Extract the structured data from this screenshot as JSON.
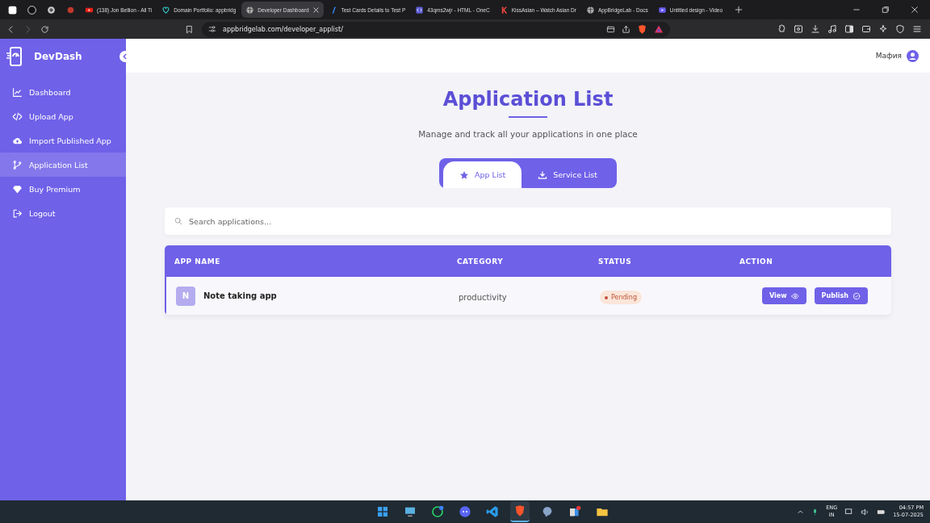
{
  "browser": {
    "tabs": [
      {
        "selected": false
      },
      {
        "selected": false
      },
      {
        "selected": false
      },
      {
        "selected": false
      },
      {
        "title": "(138) Jon Bellion - All Ti",
        "selected": false
      },
      {
        "title": "Domain Portfolio: appbridg",
        "selected": false
      },
      {
        "title": "Developer Dashboard",
        "selected": true
      },
      {
        "title": "Test Cards Details to Test P",
        "selected": false
      },
      {
        "title": "43qms2wjr - HTML - OneC",
        "selected": false
      },
      {
        "title": "KissAsian – Watch Asian Dr",
        "selected": false
      },
      {
        "title": "AppBridgeLab - Docs",
        "selected": false
      },
      {
        "title": "Untitled design - Video",
        "selected": false
      }
    ],
    "url": "appbridgelab.com/developer_applist/"
  },
  "sidebar": {
    "brand": "DevDash",
    "items": [
      {
        "label": "Dashboard",
        "selected": false
      },
      {
        "label": "Upload App",
        "selected": false
      },
      {
        "label": "Import Published App",
        "selected": false
      },
      {
        "label": "Application List",
        "selected": true
      },
      {
        "label": "Buy Premium",
        "selected": false
      },
      {
        "label": "Logout",
        "selected": false
      }
    ]
  },
  "header": {
    "user": "Мафия"
  },
  "page": {
    "title": "Application List",
    "subtitle": "Manage and track all your applications in one place",
    "tabs": [
      {
        "label": "App List",
        "selected": true
      },
      {
        "label": "Service List",
        "selected": false
      }
    ],
    "search": {
      "placeholder": "Search applications..."
    },
    "table": {
      "columns": [
        "APP NAME",
        "CATEGORY",
        "STATUS",
        "ACTION"
      ],
      "rows": [
        {
          "initial": "N",
          "name": "Note taking app",
          "category": "productivity",
          "status": {
            "label": "Pending",
            "kind": "pending"
          },
          "actions": [
            "View",
            "Publish"
          ]
        }
      ]
    }
  },
  "taskbar": {
    "language": "ENG",
    "region": "IN",
    "time": "04:57 PM",
    "date": "15-07-2025"
  }
}
